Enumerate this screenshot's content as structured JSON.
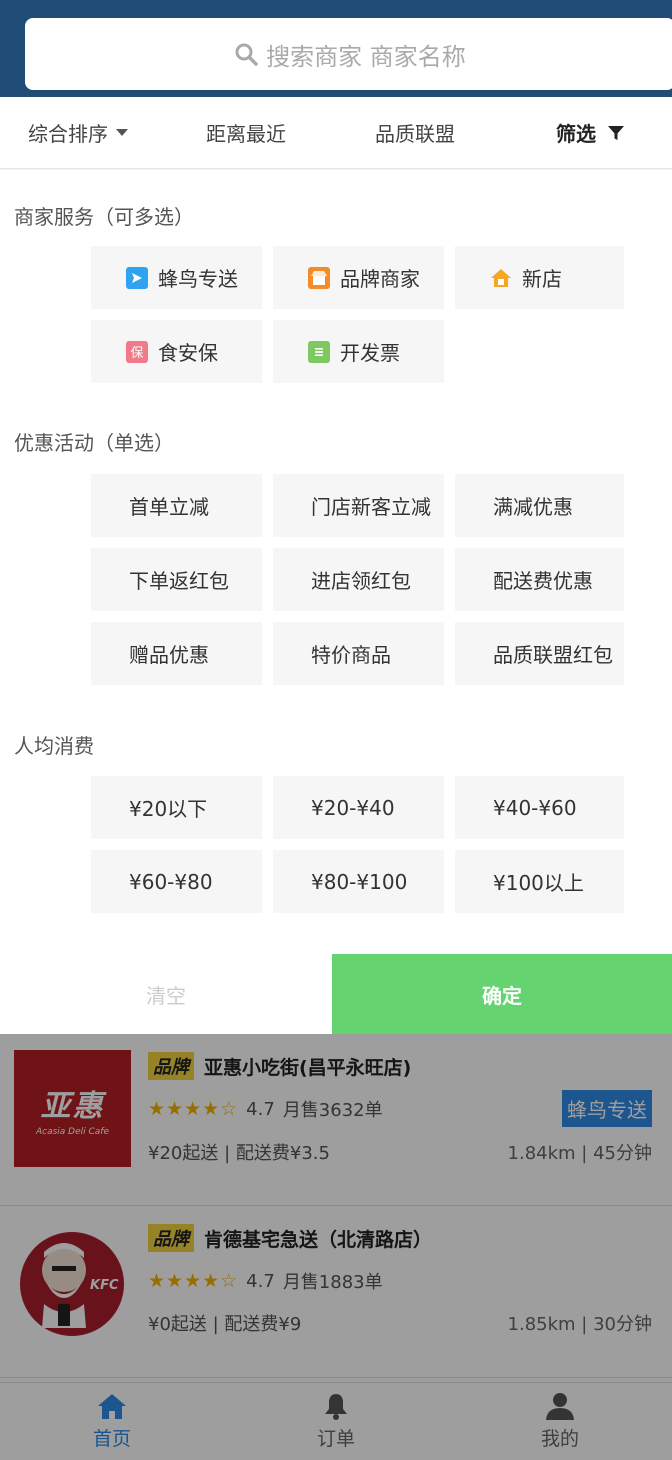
{
  "search": {
    "placeholder": "搜索商家 商家名称"
  },
  "sort_bar": {
    "items": [
      {
        "label": "综合排序"
      },
      {
        "label": "距离最近"
      },
      {
        "label": "品质联盟"
      },
      {
        "label": "筛选"
      }
    ]
  },
  "filter": {
    "services": {
      "title": "商家服务（可多选）",
      "options": [
        {
          "label": "蜂鸟专送",
          "icon": "send-icon",
          "color": "#2fa3f0"
        },
        {
          "label": "品牌商家",
          "icon": "store-icon",
          "color": "#f58a28"
        },
        {
          "label": "新店",
          "icon": "home-icon",
          "color": "#f5a623"
        },
        {
          "label": "食安保",
          "icon": "shield-icon",
          "color": "#f07a8a",
          "glyph": "保"
        },
        {
          "label": "开发票",
          "icon": "invoice-icon",
          "color": "#7ec860"
        }
      ]
    },
    "promotions": {
      "title": "优惠活动（单选）",
      "options": [
        "首单立减",
        "门店新客立减",
        "满减优惠",
        "下单返红包",
        "进店领红包",
        "配送费优惠",
        "赠品优惠",
        "特价商品",
        "品质联盟红包"
      ]
    },
    "price": {
      "title": "人均消费",
      "options": [
        "¥20以下",
        "¥20-¥40",
        "¥40-¥60",
        "¥60-¥80",
        "¥80-¥100",
        "¥100以上"
      ]
    },
    "clear_label": "清空",
    "confirm_label": "确定"
  },
  "shops": [
    {
      "tag": "品牌",
      "name": "亚惠小吃街(昌平永旺店)",
      "stars": "★★★★☆",
      "rating": "4.7",
      "sales": "月售3632单",
      "price": "¥20起送 | 配送费¥3.5",
      "distance": "1.84km | 45分钟",
      "badge": "蜂鸟专送",
      "logo_text": "亚惠",
      "logo_sub": "Acasia Deli Cafe"
    },
    {
      "tag": "品牌",
      "name": "肯德基宅急送（北清路店）",
      "stars": "★★★★☆",
      "rating": "4.7",
      "sales": "月售1883单",
      "price": "¥0起送 | 配送费¥9",
      "distance": "1.85km | 30分钟",
      "logo_text": "KFC"
    }
  ],
  "tabs": [
    {
      "label": "首页",
      "icon": "home-icon",
      "active": true
    },
    {
      "label": "订单",
      "icon": "bell-icon"
    },
    {
      "label": "我的",
      "icon": "user-icon"
    }
  ],
  "colors": {
    "header": "#1f4d78",
    "confirm": "#65d470",
    "accent": "#2f8ae5"
  }
}
